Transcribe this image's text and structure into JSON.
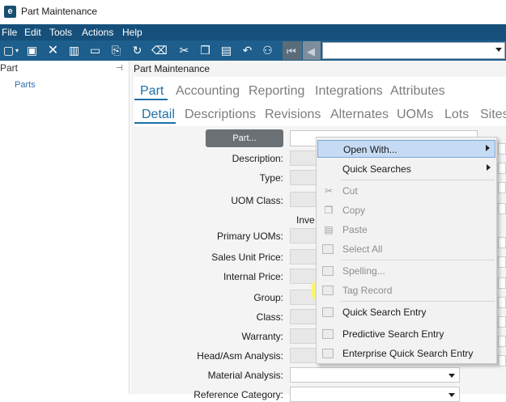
{
  "window": {
    "title": "Part Maintenance"
  },
  "menu": [
    "File",
    "Edit",
    "Tools",
    "Actions",
    "Help"
  ],
  "tree": {
    "header": "Part",
    "item": "Parts"
  },
  "main": {
    "header": "Part Maintenance",
    "tabs": [
      "Part",
      "Accounting",
      "Reporting",
      "Integrations",
      "Attributes"
    ],
    "subtabs": [
      "Detail",
      "Descriptions",
      "Revisions",
      "Alternates",
      "UOMs",
      "Lots",
      "Sites"
    ],
    "part_button": "Part...",
    "fields": [
      "Description:",
      "Type:",
      "UOM Class:",
      "Primary UOMs:",
      "Sales Unit Price:",
      "Internal Price:",
      "Group:",
      "Class:",
      "Warranty:",
      "Head/Asm Analysis:",
      "Material Analysis:",
      "Reference Category:"
    ],
    "inventory_label": "Inve"
  },
  "context_menu": {
    "items": [
      {
        "label": "Open With...",
        "state": "hover",
        "submenu": true,
        "icon": "none"
      },
      {
        "label": "Quick Searches",
        "state": "enabled",
        "submenu": true,
        "icon": "none"
      },
      {
        "label": "Cut",
        "state": "disabled",
        "icon": "scissors-icon"
      },
      {
        "label": "Copy",
        "state": "disabled",
        "icon": "copy-icon"
      },
      {
        "label": "Paste",
        "state": "disabled",
        "icon": "paste-icon"
      },
      {
        "label": "Select All",
        "state": "disabled",
        "icon": "select-all-icon"
      },
      {
        "label": "Spelling...",
        "state": "disabled",
        "icon": "spelling-icon"
      },
      {
        "label": "Tag Record",
        "state": "disabled",
        "icon": "tag-icon",
        "highlighted": true
      },
      {
        "label": "Quick Search Entry",
        "state": "enabled",
        "icon": "quick-search-icon"
      },
      {
        "label": "Predictive Search Entry",
        "state": "enabled",
        "icon": "predictive-search-icon"
      },
      {
        "label": "Enterprise Quick Search Entry",
        "state": "enabled",
        "icon": "enterprise-search-icon"
      }
    ]
  },
  "colors": {
    "menubar": "#16507a",
    "toolbar": "#1d5e8c",
    "tab_active": "#1e6fa8",
    "menu_hover": "#c5daf3",
    "marker_highlight": "#fbf75a"
  }
}
